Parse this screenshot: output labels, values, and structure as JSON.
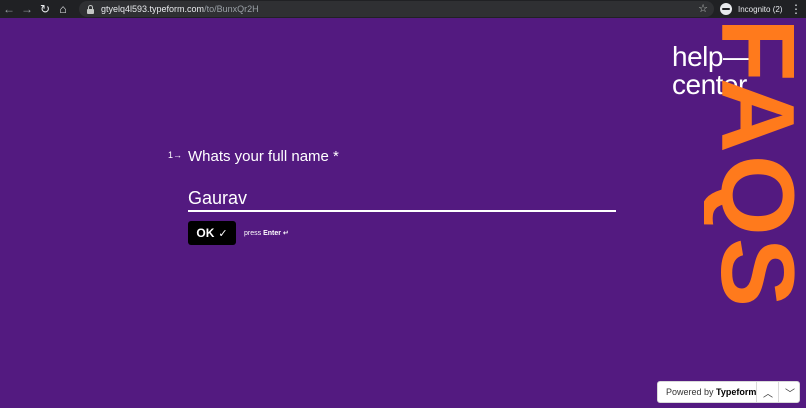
{
  "browser": {
    "back_icon": "←",
    "forward_icon": "→",
    "reload_icon": "↻",
    "home_icon": "⌂",
    "url_host": "gtyelq4l593.typeform.com",
    "url_path": "/to/BunxQr2H",
    "star_icon": "☆",
    "incognito_label": "Incognito (2)",
    "menu_icon": "⋮"
  },
  "question": {
    "number": "1→",
    "text": "Whats your full name *",
    "answer": "Gaurav"
  },
  "ok_button": {
    "label": "OK",
    "check": "✓"
  },
  "hint": {
    "prefix": "press",
    "key": "Enter ↵"
  },
  "brand": {
    "line1": "help—",
    "line2": "center",
    "faqs": "FAQS"
  },
  "footer": {
    "powered_by": "Powered by",
    "typeform": "Typeform",
    "up_icon": "︿",
    "down_icon": "﹀"
  },
  "colors": {
    "background": "#531a80",
    "accent": "#ff7a1c"
  }
}
